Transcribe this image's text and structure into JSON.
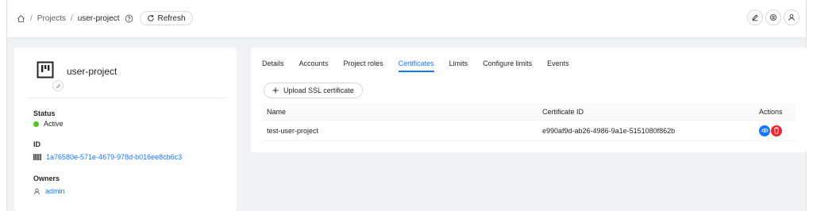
{
  "breadcrumb": {
    "home_icon": "home-icon",
    "sep1": "/",
    "projects": "Projects",
    "sep2": "/",
    "current": "user-project",
    "help_icon": "help-circle-icon"
  },
  "toolbar": {
    "refresh_label": "Refresh",
    "refresh_icon": "refresh-icon",
    "actions": [
      "edit-icon",
      "settings-icon",
      "user-icon"
    ]
  },
  "project": {
    "name": "user-project",
    "logo_icon": "project-logo-icon",
    "status_label": "Status",
    "status_value": "Active",
    "status_color": "#52c41a",
    "id_label": "ID",
    "id_value": "1a76580e-571e-4679-978d-b016ee8cb6c3",
    "owners_label": "Owners",
    "owner": "admin"
  },
  "tabs": [
    {
      "label": "Details",
      "active": false
    },
    {
      "label": "Accounts",
      "active": false
    },
    {
      "label": "Project roles",
      "active": false
    },
    {
      "label": "Certificates",
      "active": true
    },
    {
      "label": "Limits",
      "active": false
    },
    {
      "label": "Configure limits",
      "active": false
    },
    {
      "label": "Events",
      "active": false
    }
  ],
  "upload_button": "Upload SSL certificate",
  "table": {
    "columns": [
      "Name",
      "Certificate ID",
      "Actions"
    ],
    "rows": [
      {
        "name": "test-user-project",
        "certificate_id": "e990af9d-ab26-4986-9a1e-5151080f862b"
      }
    ]
  },
  "colors": {
    "accent": "#1677ff",
    "danger": "#f5222d",
    "view": "#1677ff"
  }
}
